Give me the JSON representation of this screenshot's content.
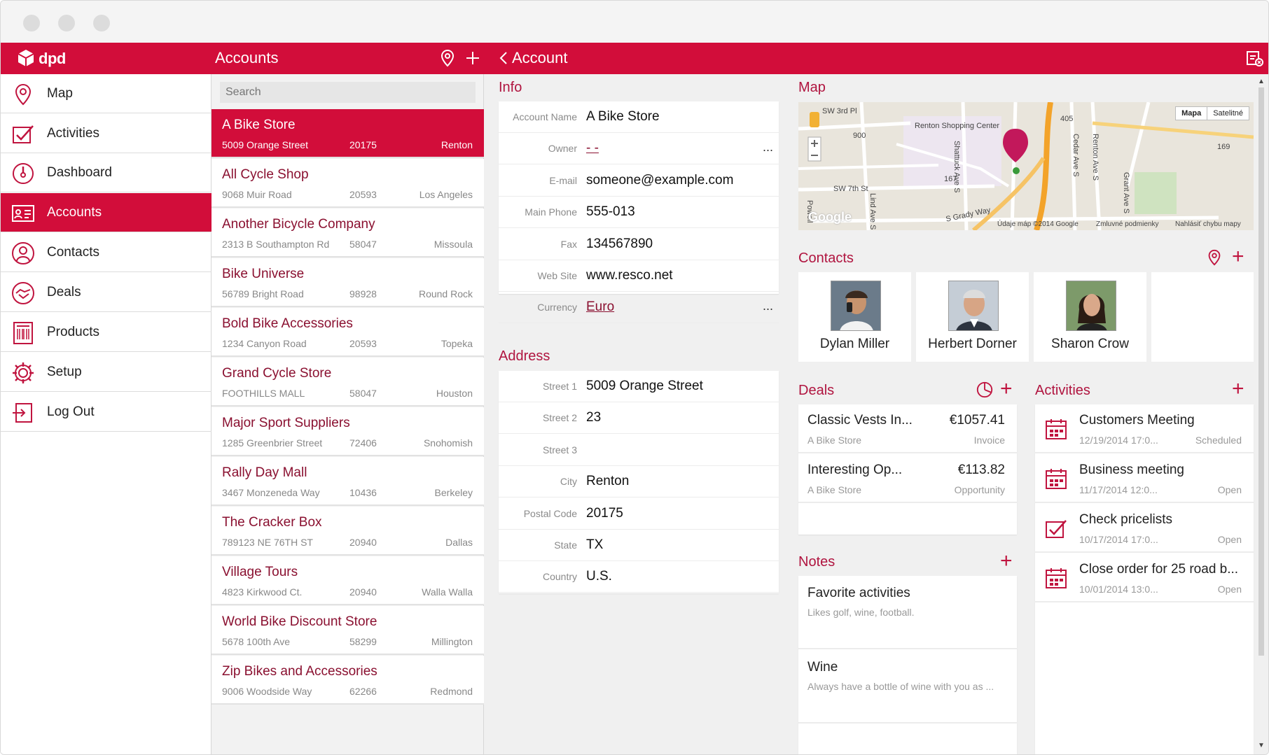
{
  "window": {
    "dots": [
      "close",
      "minimize",
      "maximize"
    ]
  },
  "colors": {
    "accent": "#d20d3a",
    "link": "#8a1030",
    "section": "#b0143f"
  },
  "topbar": {
    "brand": "dpd",
    "accounts_title": "Accounts",
    "account_title": "Account"
  },
  "sidebar": {
    "items": [
      {
        "label": "Map",
        "icon": "map-pin-icon"
      },
      {
        "label": "Activities",
        "icon": "checklist-icon"
      },
      {
        "label": "Dashboard",
        "icon": "gauge-icon"
      },
      {
        "label": "Accounts",
        "icon": "id-card-icon",
        "active": true
      },
      {
        "label": "Contacts",
        "icon": "person-icon"
      },
      {
        "label": "Deals",
        "icon": "handshake-icon"
      },
      {
        "label": "Products",
        "icon": "barcode-icon"
      },
      {
        "label": "Setup",
        "icon": "gear-icon"
      },
      {
        "label": "Log Out",
        "icon": "logout-icon"
      }
    ]
  },
  "accounts": {
    "search_placeholder": "Search",
    "rows": [
      {
        "name": "A Bike Store",
        "street": "5009 Orange Street",
        "zip": "20175",
        "city": "Renton",
        "selected": true
      },
      {
        "name": "All Cycle Shop",
        "street": "9068 Muir Road",
        "zip": "20593",
        "city": "Los Angeles"
      },
      {
        "name": "Another Bicycle Company",
        "street": "2313 B Southampton Rd",
        "zip": "58047",
        "city": "Missoula"
      },
      {
        "name": "Bike Universe",
        "street": "56789 Bright Road",
        "zip": "98928",
        "city": "Round Rock"
      },
      {
        "name": "Bold Bike Accessories",
        "street": "1234 Canyon Road",
        "zip": "20593",
        "city": "Topeka"
      },
      {
        "name": "Grand Cycle Store",
        "street": "FOOTHILLS MALL",
        "zip": "58047",
        "city": "Houston"
      },
      {
        "name": "Major Sport Suppliers",
        "street": "1285 Greenbrier Street",
        "zip": "72406",
        "city": "Snohomish"
      },
      {
        "name": "Rally Day Mall",
        "street": "3467 Monzeneda Way",
        "zip": "10436",
        "city": "Berkeley"
      },
      {
        "name": "The Cracker Box",
        "street": "789123 NE 76TH ST",
        "zip": "20940",
        "city": "Dallas"
      },
      {
        "name": "Village Tours",
        "street": "4823 Kirkwood Ct.",
        "zip": "20940",
        "city": "Walla Walla"
      },
      {
        "name": "World Bike Discount Store",
        "street": "5678 100th Ave",
        "zip": "58299",
        "city": "Millington"
      },
      {
        "name": "Zip Bikes and Accessories",
        "street": "9006 Woodside Way",
        "zip": "62266",
        "city": "Redmond"
      }
    ]
  },
  "info": {
    "title": "Info",
    "fields": [
      {
        "label": "Account Name",
        "value": "A Bike Store"
      },
      {
        "label": "Owner",
        "value": "- -",
        "link": true,
        "more": "..."
      },
      {
        "label": "E-mail",
        "value": "someone@example.com"
      },
      {
        "label": "Main Phone",
        "value": "555-013"
      },
      {
        "label": "Fax",
        "value": "134567890"
      },
      {
        "label": "Web Site",
        "value": "www.resco.net"
      },
      {
        "label": "Currency",
        "value": "Euro",
        "link": true,
        "more": "..."
      }
    ]
  },
  "address": {
    "title": "Address",
    "fields": [
      {
        "label": "Street 1",
        "value": "5009 Orange Street"
      },
      {
        "label": "Street 2",
        "value": "23"
      },
      {
        "label": "Street 3",
        "value": ""
      },
      {
        "label": "City",
        "value": "Renton"
      },
      {
        "label": "Postal Code",
        "value": "20175"
      },
      {
        "label": "State",
        "value": "TX"
      },
      {
        "label": "Country",
        "value": "U.S."
      }
    ]
  },
  "map": {
    "title": "Map",
    "type_map": "Mapa",
    "type_sat": "Satelitné",
    "labels": {
      "sw3rd": "SW 3rd Pl",
      "renton_center": "Renton Shopping Center",
      "sw7th": "SW 7th St",
      "shattuck": "Shattuck Ave S",
      "cedar": "Cedar Ave S",
      "renton_ave": "Renton Ave S",
      "grant": "Grant Ave S",
      "lind": "Lind Ave S",
      "powell": "Powell",
      "grady": "S Grady Way",
      "r900": "900",
      "r167": "167",
      "r169": "169",
      "r405": "405",
      "google": "Google",
      "footer1": "Údaje máp ©2014 Google",
      "footer2": "Zmluvné podmienky",
      "footer3": "Nahlásiť chybu mapy"
    }
  },
  "contacts": {
    "title": "Contacts",
    "items": [
      {
        "name": "Dylan Miller"
      },
      {
        "name": "Herbert Dorner"
      },
      {
        "name": "Sharon Crow"
      }
    ]
  },
  "deals": {
    "title": "Deals",
    "items": [
      {
        "name": "Classic Vests In...",
        "amount": "€1057.41",
        "account": "A Bike Store",
        "stage": "Invoice"
      },
      {
        "name": "Interesting Op...",
        "amount": "€113.82",
        "account": "A Bike Store",
        "stage": "Opportunity"
      }
    ]
  },
  "notes": {
    "title": "Notes",
    "items": [
      {
        "title": "Favorite activities",
        "text": "Likes golf, wine, football."
      },
      {
        "title": "Wine",
        "text": "Always have a bottle of wine with you as ..."
      }
    ]
  },
  "activities": {
    "title": "Activities",
    "items": [
      {
        "title": "Customers Meeting",
        "date": "12/19/2014 17:0...",
        "status": "Scheduled",
        "icon": "calendar-icon"
      },
      {
        "title": "Business meeting",
        "date": "11/17/2014 12:0...",
        "status": "Open",
        "icon": "calendar-icon"
      },
      {
        "title": "Check pricelists",
        "date": "10/17/2014 17:0...",
        "status": "Open",
        "icon": "task-icon"
      },
      {
        "title": "Close order for 25 road b...",
        "date": "10/01/2014 13:0...",
        "status": "Open",
        "icon": "calendar-icon"
      }
    ]
  }
}
